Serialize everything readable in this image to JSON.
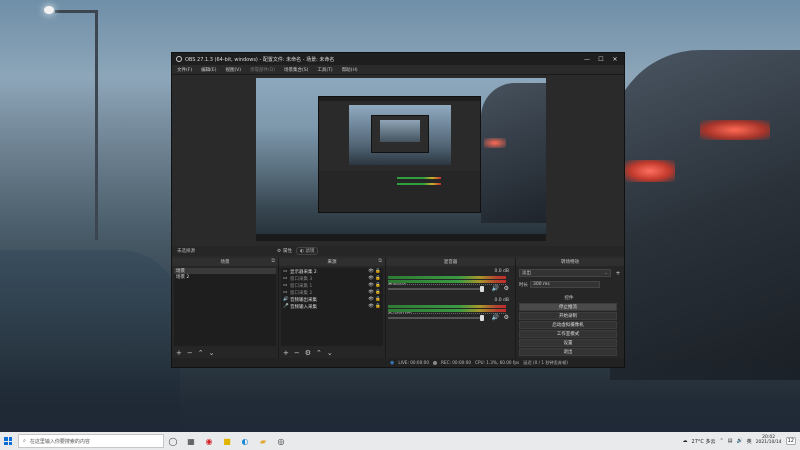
{
  "obs": {
    "title": "OBS 27.1.3 (64-bit, windows) - 配置文件: 未命名 - 场景: 未命名",
    "window_buttons": [
      "—",
      "☐",
      "✕"
    ],
    "menu": [
      "文件(F)",
      "编辑(E)",
      "视图(V)",
      "停靠部件(D)",
      "场景集合(S)",
      "工具(T)",
      "帮助(H)"
    ],
    "no_source_selected": "未选择源",
    "properties_label": "属性",
    "filters_label": "滤镜",
    "scenes": {
      "header": "场景",
      "items": [
        "场景",
        "场景 2"
      ]
    },
    "sources": {
      "header": "来源",
      "items": [
        {
          "icon": "▭",
          "label": "显示器采集 2",
          "dim": false
        },
        {
          "icon": "▭",
          "label": "窗口采集 3",
          "dim": true
        },
        {
          "icon": "▭",
          "label": "窗口采集 1",
          "dim": true
        },
        {
          "icon": "▭",
          "label": "窗口采集 2",
          "dim": true
        },
        {
          "icon": "🔊",
          "label": "音频输出采集",
          "dim": false
        },
        {
          "icon": "🎤",
          "label": "音频输入采集",
          "dim": false
        }
      ]
    },
    "mixer": {
      "header": "混音器",
      "channels": [
        {
          "name": "桌面音频",
          "db": "0.0 dB"
        },
        {
          "name": "麦克风/Aux",
          "db": "0.0 dB"
        }
      ]
    },
    "transitions": {
      "header": "转场特效",
      "selected": "淡出",
      "duration_label": "时长",
      "duration_value": "300 ms"
    },
    "controls": {
      "header": "控件",
      "buttons": [
        "停止推流",
        "开始录制",
        "启动虚拟摄像机",
        "工作室模式",
        "设置",
        "退出"
      ]
    },
    "status": {
      "live": "LIVE: 00:00:00",
      "rec": "REC: 00:00:00",
      "cpu": "CPU: 1.3%, 60.00 fps",
      "dropped": "延迟 (0 / 1 秒钟丢弃帧)"
    }
  },
  "taskbar": {
    "search_placeholder": "在这里输入你要搜索的内容",
    "weather": "27°C 多云",
    "ime": "英",
    "time": "20:02",
    "date": "2021/10/14",
    "notification_count": "12"
  }
}
